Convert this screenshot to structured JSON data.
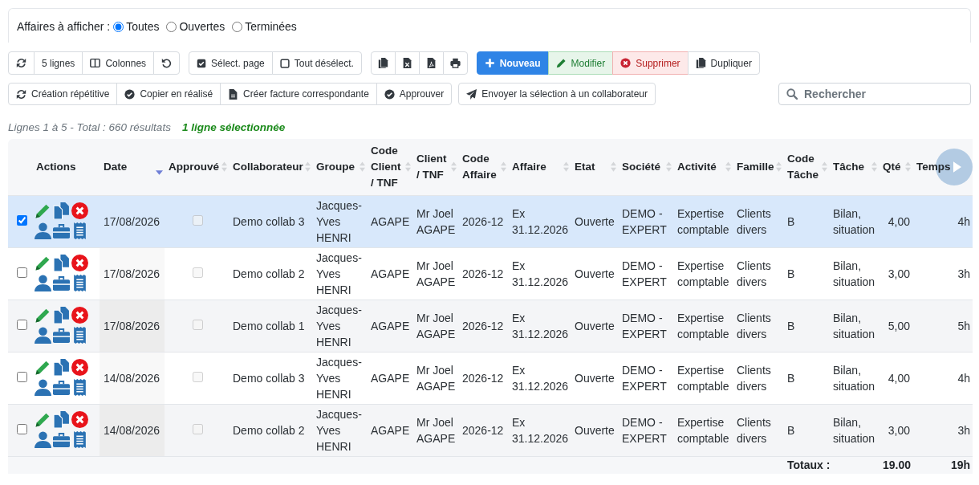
{
  "filter": {
    "label": "Affaires à afficher :",
    "options": [
      {
        "label": "Toutes",
        "selected": true
      },
      {
        "label": "Ouvertes",
        "selected": false
      },
      {
        "label": "Terminées",
        "selected": false
      }
    ]
  },
  "toolbar": {
    "page_size": "5 lignes",
    "columns": "Colonnes",
    "select_page": "Sélect. page",
    "deselect_all": "Tout désélect.",
    "actions": [
      {
        "label": "Nouveau",
        "kind": "create"
      },
      {
        "label": "Modifier",
        "kind": "edit"
      },
      {
        "label": "Supprimer",
        "kind": "delete"
      },
      {
        "label": "Dupliquer",
        "kind": "duplicate"
      }
    ],
    "bulk_actions": [
      "Création répétitive",
      "Copier en réalisé",
      "Créer facture correspondante",
      "Approuver"
    ],
    "send": "Envoyer la sélection à un collaborateur"
  },
  "search": {
    "placeholder": "Rechercher"
  },
  "summary": {
    "count": "Lignes 1 à 5 - Total : 660 résultats",
    "selection": "1 ligne sélectionnée"
  },
  "table": {
    "columns": [
      {
        "label": "Actions",
        "sort_icon": false,
        "sorted": false
      },
      {
        "label": "Date",
        "sort_icon": true,
        "sorted": true
      },
      {
        "label": "Approuvé",
        "sort_icon": true,
        "sorted": false
      },
      {
        "label": "Collaborateur",
        "sort_icon": true,
        "sorted": false
      },
      {
        "label": "Groupe",
        "sort_icon": true,
        "sorted": false
      },
      {
        "label": "Code Client / TNF",
        "sort_icon": true,
        "sorted": false
      },
      {
        "label": "Client / TNF",
        "sort_icon": true,
        "sorted": false
      },
      {
        "label": "Code Affaire",
        "sort_icon": true,
        "sorted": false
      },
      {
        "label": "Affaire",
        "sort_icon": true,
        "sorted": false
      },
      {
        "label": "Etat",
        "sort_icon": true,
        "sorted": false
      },
      {
        "label": "Société",
        "sort_icon": true,
        "sorted": false
      },
      {
        "label": "Activité",
        "sort_icon": true,
        "sorted": false
      },
      {
        "label": "Famille",
        "sort_icon": true,
        "sorted": false
      },
      {
        "label": "Code Tâche",
        "sort_icon": true,
        "sorted": false
      },
      {
        "label": "Tâche",
        "sort_icon": true,
        "sorted": false
      },
      {
        "label": "Qté",
        "sort_icon": true,
        "sorted": false
      },
      {
        "label": "Temps",
        "sort_icon": false,
        "sorted": false
      }
    ],
    "rows": [
      {
        "selected": true,
        "date": "17/08/2026",
        "approved": false,
        "collaborator": "Demo collab 3",
        "group": "Jacques-Yves HENRI",
        "client_code": "AGAPE",
        "client": "Mr Joel AGAPE",
        "job_code": "2026-12",
        "job": "Ex 31.12.2026",
        "status": "Ouverte",
        "company": "DEMO - EXPERT",
        "activity": "Expertise comptable",
        "family": "Clients divers",
        "task_code": "B",
        "task": "Bilan, situation",
        "qty": "4,00",
        "time": "4h"
      },
      {
        "selected": false,
        "date": "17/08/2026",
        "approved": false,
        "collaborator": "Demo collab 2",
        "group": "Jacques-Yves HENRI",
        "client_code": "AGAPE",
        "client": "Mr Joel AGAPE",
        "job_code": "2026-12",
        "job": "Ex 31.12.2026",
        "status": "Ouverte",
        "company": "DEMO - EXPERT",
        "activity": "Expertise comptable",
        "family": "Clients divers",
        "task_code": "B",
        "task": "Bilan, situation",
        "qty": "3,00",
        "time": "3h"
      },
      {
        "selected": false,
        "date": "17/08/2026",
        "approved": false,
        "collaborator": "Demo collab 1",
        "group": "Jacques-Yves HENRI",
        "client_code": "AGAPE",
        "client": "Mr Joel AGAPE",
        "job_code": "2026-12",
        "job": "Ex 31.12.2026",
        "status": "Ouverte",
        "company": "DEMO - EXPERT",
        "activity": "Expertise comptable",
        "family": "Clients divers",
        "task_code": "B",
        "task": "Bilan, situation",
        "qty": "5,00",
        "time": "5h"
      },
      {
        "selected": false,
        "date": "14/08/2026",
        "approved": false,
        "collaborator": "Demo collab 3",
        "group": "Jacques-Yves HENRI",
        "client_code": "AGAPE",
        "client": "Mr Joel AGAPE",
        "job_code": "2026-12",
        "job": "Ex 31.12.2026",
        "status": "Ouverte",
        "company": "DEMO - EXPERT",
        "activity": "Expertise comptable",
        "family": "Clients divers",
        "task_code": "B",
        "task": "Bilan, situation",
        "qty": "4,00",
        "time": "4h"
      },
      {
        "selected": false,
        "date": "14/08/2026",
        "approved": false,
        "collaborator": "Demo collab 2",
        "group": "Jacques-Yves HENRI",
        "client_code": "AGAPE",
        "client": "Mr Joel AGAPE",
        "job_code": "2026-12",
        "job": "Ex 31.12.2026",
        "status": "Ouverte",
        "company": "DEMO - EXPERT",
        "activity": "Expertise comptable",
        "family": "Clients divers",
        "task_code": "B",
        "task": "Bilan, situation",
        "qty": "3,00",
        "time": "3h"
      }
    ],
    "totals": {
      "label": "Totaux :",
      "qty": "19.00",
      "time": "19h"
    }
  }
}
